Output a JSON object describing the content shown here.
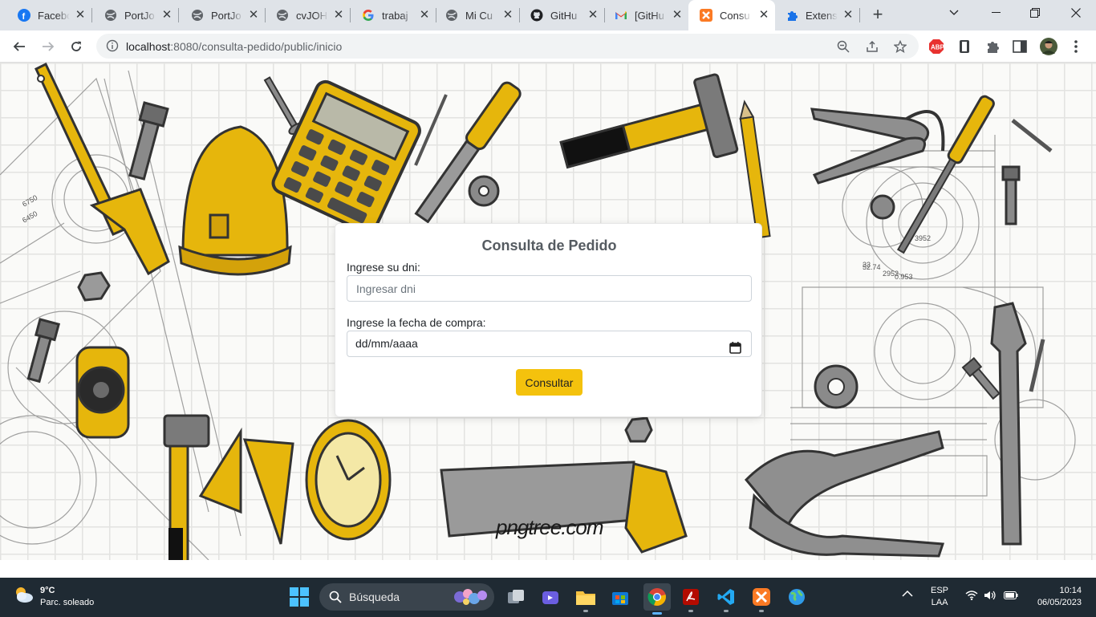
{
  "browser": {
    "tabs": [
      {
        "title": "Facebook",
        "icon": "facebook-icon",
        "active": false
      },
      {
        "title": "PortJo",
        "icon": "globe-icon",
        "active": false
      },
      {
        "title": "PortJo",
        "icon": "globe-icon",
        "active": false
      },
      {
        "title": "cvJOH",
        "icon": "globe-icon",
        "active": false
      },
      {
        "title": "trabaj",
        "icon": "google-icon",
        "active": false
      },
      {
        "title": "Mi Cu",
        "icon": "globe-icon",
        "active": false
      },
      {
        "title": "GitHu",
        "icon": "github-icon",
        "active": false
      },
      {
        "title": "[GitHu",
        "icon": "gmail-icon",
        "active": false
      },
      {
        "title": "Consu",
        "icon": "xampp-icon",
        "active": true
      },
      {
        "title": "Extens",
        "icon": "puzzle-icon",
        "active": false
      }
    ],
    "url_host": "localhost",
    "url_path": ":8080/consulta-pedido/public/inicio",
    "abp_label": "ABP"
  },
  "page": {
    "form_title": "Consulta de Pedido",
    "dni_label": "Ingrese su dni:",
    "dni_placeholder": "Ingresar dni",
    "date_label": "Ingrese la fecha de compra:",
    "date_value": "dd/mm/aaaa",
    "submit_label": "Consultar",
    "watermark": "pngtree.com"
  },
  "taskbar": {
    "weather_temp": "9°C",
    "weather_desc": "Parc. soleado",
    "search_label": "Búsqueda",
    "lang_top": "ESP",
    "lang_bottom": "LAA",
    "time": "10:14",
    "date": "06/05/2023"
  },
  "colors": {
    "accent_yellow": "#f4c20d",
    "taskbar": "#1f2a33",
    "tabstrip": "#dfe3e8"
  }
}
